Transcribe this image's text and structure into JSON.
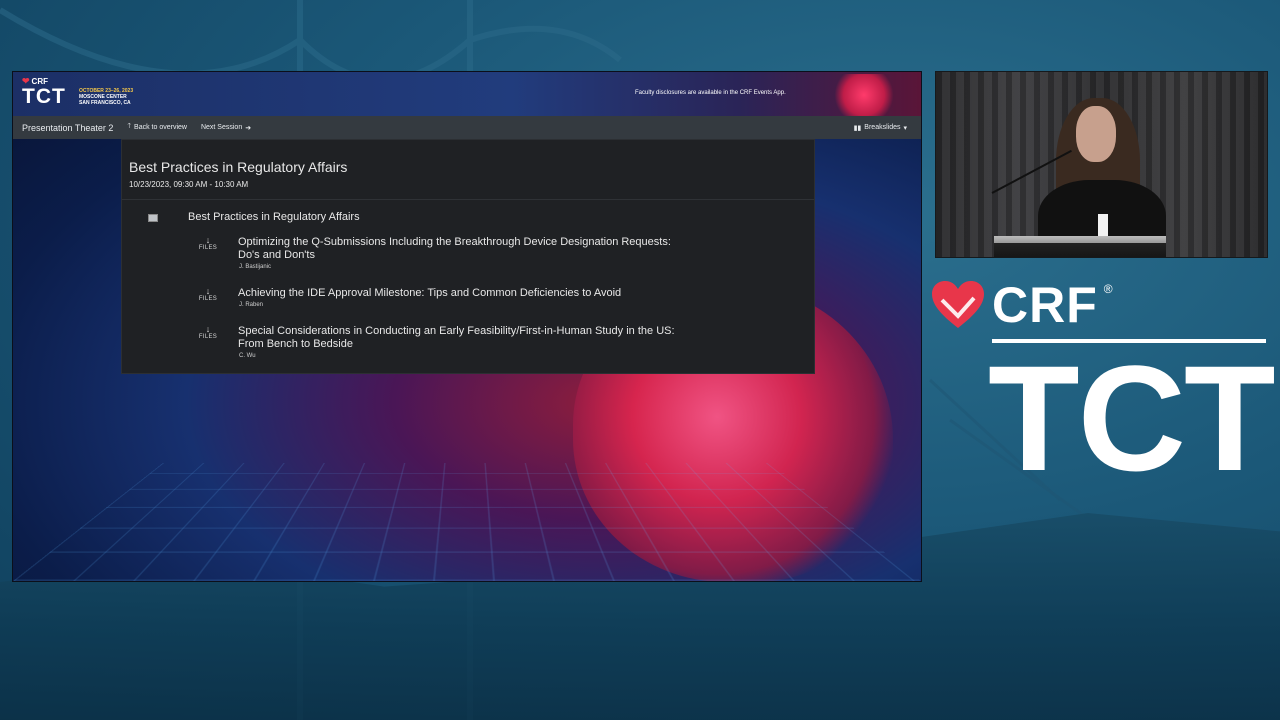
{
  "banner": {
    "crf": "CRF",
    "tct": "TCT",
    "dates": [
      "OCTOBER 23–26, 2023",
      "MOSCONE CENTER",
      "SAN FRANCISCO, CA"
    ],
    "disclosure": "Faculty disclosures are available in the CRF Events App."
  },
  "nav": {
    "brand": "Presentation Theater 2",
    "back": "Back to overview",
    "next": "Next Session",
    "breakslides": "Breakslides"
  },
  "session": {
    "title": "Best Practices in Regulatory Affairs",
    "datetime": "10/23/2023, 09:30 AM - 10:30 AM",
    "section_title": "Best Practices in Regulatory Affairs",
    "files_label": "FILES",
    "talks": [
      {
        "title_line1": "Optimizing the Q-Submissions Including the Breakthrough Device Designation Requests:",
        "title_line2": "Do's and Don'ts",
        "author": "J. Bastijanic"
      },
      {
        "title_line1": "Achieving the IDE Approval Milestone: Tips and Common Deficiencies to Avoid",
        "title_line2": "",
        "author": "J. Raben"
      },
      {
        "title_line1": "Special Considerations in Conducting an Early Feasibility/First-in-Human Study in the US:",
        "title_line2": "From Bench to Bedside",
        "author": "C. Wu"
      }
    ]
  },
  "brand": {
    "crf": "CRF",
    "reg": "®",
    "tct": "TCT"
  },
  "colors": {
    "background": "#1b5878",
    "navbar": "#343a40",
    "panel": "#1f2124",
    "crf_heart": "#e8364a",
    "date_accent": "#f6c94a"
  },
  "icons": {
    "download": "download-arrow-icon",
    "section": "section-square-icon",
    "back": "arrow-up-icon",
    "next": "arrow-right-icon",
    "breakslides": "columns-icon"
  }
}
